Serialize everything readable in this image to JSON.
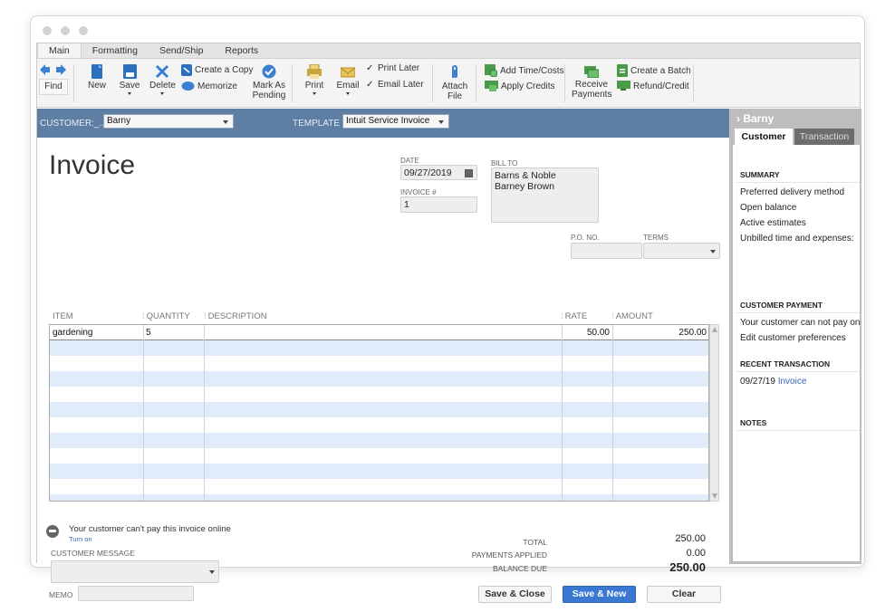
{
  "window": {
    "controls": [
      "close",
      "minimize",
      "maximize"
    ]
  },
  "tabs": [
    {
      "label": "Main",
      "active": true
    },
    {
      "label": "Formatting",
      "active": false
    },
    {
      "label": "Send/Ship",
      "active": false
    },
    {
      "label": "Reports",
      "active": false
    }
  ],
  "toolbar": {
    "find": "Find",
    "new": "New",
    "save": "Save",
    "delete": "Delete",
    "create_copy": "Create a Copy",
    "memorize": "Memorize",
    "mark_pending_1": "Mark As",
    "mark_pending_2": "Pending",
    "print": "Print",
    "email": "Email",
    "print_later": "Print Later",
    "email_later": "Email Later",
    "print_later_checked": true,
    "email_later_checked": true,
    "attach_1": "Attach",
    "attach_2": "File",
    "add_time_costs": "Add Time/Costs",
    "apply_credits": "Apply Credits",
    "receive_1": "Receive",
    "receive_2": "Payments",
    "create_batch": "Create a Batch",
    "refund_credit": "Refund/Credit"
  },
  "customer_bar": {
    "customer_label": "CUSTOMER:_..",
    "customer_value": "Barny",
    "template_label": "TEMPLATE",
    "template_value": "Intuit Service Invoice"
  },
  "form": {
    "title": "Invoice",
    "date_label": "DATE",
    "date_value": "09/27/2019",
    "invoice_no_label": "INVOICE #",
    "invoice_no_value": "1",
    "bill_to_label": "BILL TO",
    "bill_to_lines": [
      "Barns & Noble",
      "Barney Brown"
    ],
    "po_label": "P.O. NO.",
    "po_value": "",
    "terms_label": "TERMS",
    "terms_value": ""
  },
  "grid": {
    "columns": [
      "ITEM",
      "QUANTITY",
      "DESCRIPTION",
      "RATE",
      "AMOUNT"
    ],
    "rows": [
      {
        "item": "gardening",
        "quantity": "5",
        "description": "",
        "rate": "50.00",
        "amount": "250.00"
      }
    ]
  },
  "footer": {
    "online_pay_msg": "Your customer can't pay this invoice online",
    "turn_on": "Turn on",
    "customer_message_label": "CUSTOMER MESSAGE",
    "customer_message_value": "",
    "memo_label": "MEMO",
    "memo_value": "",
    "total_label": "TOTAL",
    "total_value": "250.00",
    "payments_label": "PAYMENTS APPLIED",
    "payments_value": "0.00",
    "balance_label": "BALANCE DUE",
    "balance_value": "250.00",
    "save_close": "Save & Close",
    "save_new": "Save & New",
    "clear": "Clear"
  },
  "right_panel": {
    "header": "Barny",
    "tab_customer": "Customer",
    "tab_transaction": "Transaction",
    "summary_title": "SUMMARY",
    "summary_items": [
      "Preferred delivery method",
      "Open balance",
      "Active estimates",
      "Unbilled time and expenses:"
    ],
    "payment_title": "CUSTOMER PAYMENT",
    "payment_text": "Your customer can not pay on",
    "payment_link": "Edit customer preferences",
    "recent_title": "RECENT TRANSACTION",
    "recent_date": "09/27/19",
    "recent_link": "Invoice",
    "notes_title": "NOTES"
  }
}
